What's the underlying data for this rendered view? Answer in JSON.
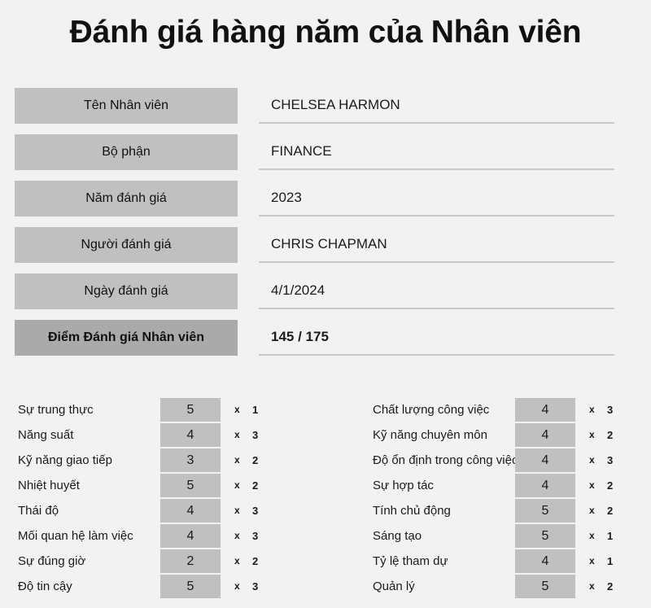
{
  "title": "Đánh giá hàng năm của Nhân viên",
  "colors": {
    "page_background": "#f2f2f2",
    "label_box": "#c0c0c0",
    "total_label_box": "#aaaaaa",
    "value_underline": "#c9c9c9",
    "text": "#1a1a1a"
  },
  "info": {
    "rows": [
      {
        "label": "Tên Nhân viên",
        "value": "CHELSEA HARMON"
      },
      {
        "label": "Bộ phận",
        "value": "FINANCE"
      },
      {
        "label": "Năm đánh giá",
        "value": "2023"
      },
      {
        "label": "Người đánh giá",
        "value": "CHRIS CHAPMAN"
      },
      {
        "label": "Ngày đánh giá",
        "value": "4/1/2024"
      },
      {
        "label": "Điểm Đánh giá Nhân viên",
        "value": "145 / 175"
      }
    ]
  },
  "criteria": {
    "multiplier_symbol": "x",
    "left": [
      {
        "name": "Sự trung thực",
        "score": "5",
        "multiplier": "1"
      },
      {
        "name": "Năng suất",
        "score": "4",
        "multiplier": "3"
      },
      {
        "name": "Kỹ năng giao tiếp",
        "score": "3",
        "multiplier": "2"
      },
      {
        "name": "Nhiệt huyết",
        "score": "5",
        "multiplier": "2"
      },
      {
        "name": "Thái độ",
        "score": "4",
        "multiplier": "3"
      },
      {
        "name": "Mối quan hệ làm việc",
        "score": "4",
        "multiplier": "3"
      },
      {
        "name": "Sự đúng giờ",
        "score": "2",
        "multiplier": "2"
      },
      {
        "name": "Độ tin cậy",
        "score": "5",
        "multiplier": "3"
      }
    ],
    "right": [
      {
        "name": "Chất lượng công việc",
        "score": "4",
        "multiplier": "3"
      },
      {
        "name": "Kỹ năng chuyên môn",
        "score": "4",
        "multiplier": "2"
      },
      {
        "name": "Độ ổn định trong công việc",
        "score": "4",
        "multiplier": "3"
      },
      {
        "name": "Sự hợp tác",
        "score": "4",
        "multiplier": "2"
      },
      {
        "name": "Tính chủ động",
        "score": "5",
        "multiplier": "2"
      },
      {
        "name": "Sáng tạo",
        "score": "5",
        "multiplier": "1"
      },
      {
        "name": "Tỷ lệ tham dự",
        "score": "4",
        "multiplier": "1"
      },
      {
        "name": "Quản lý",
        "score": "5",
        "multiplier": "2"
      }
    ]
  }
}
